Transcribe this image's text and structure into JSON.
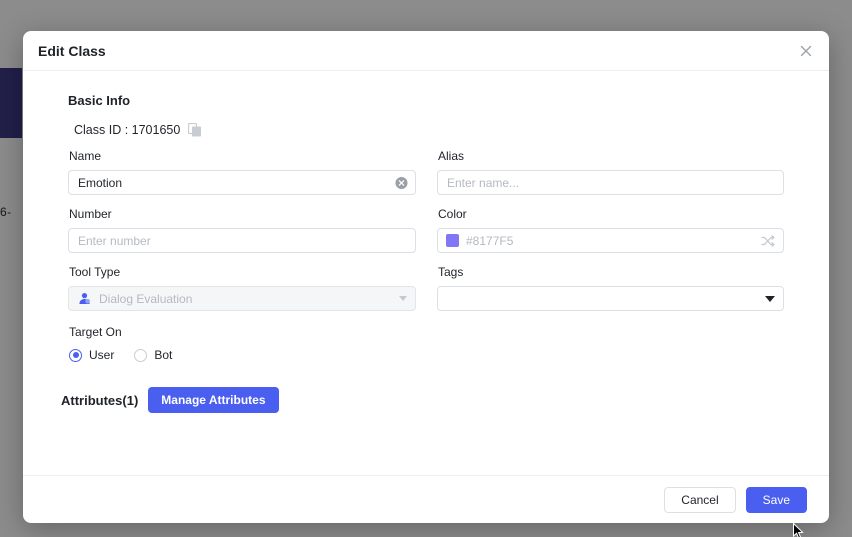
{
  "background": {
    "fragment_text": "6-"
  },
  "dialog": {
    "title": "Edit Class",
    "close_icon": "close-icon",
    "section_title": "Basic Info",
    "class_id_label": "Class ID : 1701650",
    "copy_icon": "copy-icon"
  },
  "fields": {
    "name": {
      "label": "Name",
      "value": "Emotion",
      "placeholder": "Enter name...",
      "clear_icon": "clear-circle-icon"
    },
    "alias": {
      "label": "Alias",
      "value": "",
      "placeholder": "Enter name..."
    },
    "number": {
      "label": "Number",
      "value": "",
      "placeholder": "Enter number"
    },
    "color": {
      "label": "Color",
      "value": "#8177F5",
      "swatch_hex": "#8177F5",
      "shuffle_icon": "shuffle-icon"
    },
    "tool_type": {
      "label": "Tool Type",
      "value": "Dialog Evaluation",
      "icon": "person-icon",
      "disabled": true,
      "caret_icon": "chevron-down-icon"
    },
    "tags": {
      "label": "Tags",
      "value": "",
      "caret_icon": "chevron-down-icon"
    },
    "target_on": {
      "label": "Target On",
      "options": [
        {
          "label": "User",
          "selected": true
        },
        {
          "label": "Bot",
          "selected": false
        }
      ]
    }
  },
  "attributes": {
    "label": "Attributes(1)",
    "manage_button": "Manage Attributes"
  },
  "footer": {
    "cancel_label": "Cancel",
    "save_label": "Save"
  },
  "colors": {
    "accent": "#4a5ef0",
    "swatch": "#8177F5",
    "sidebar_block": "#3f3a87"
  }
}
